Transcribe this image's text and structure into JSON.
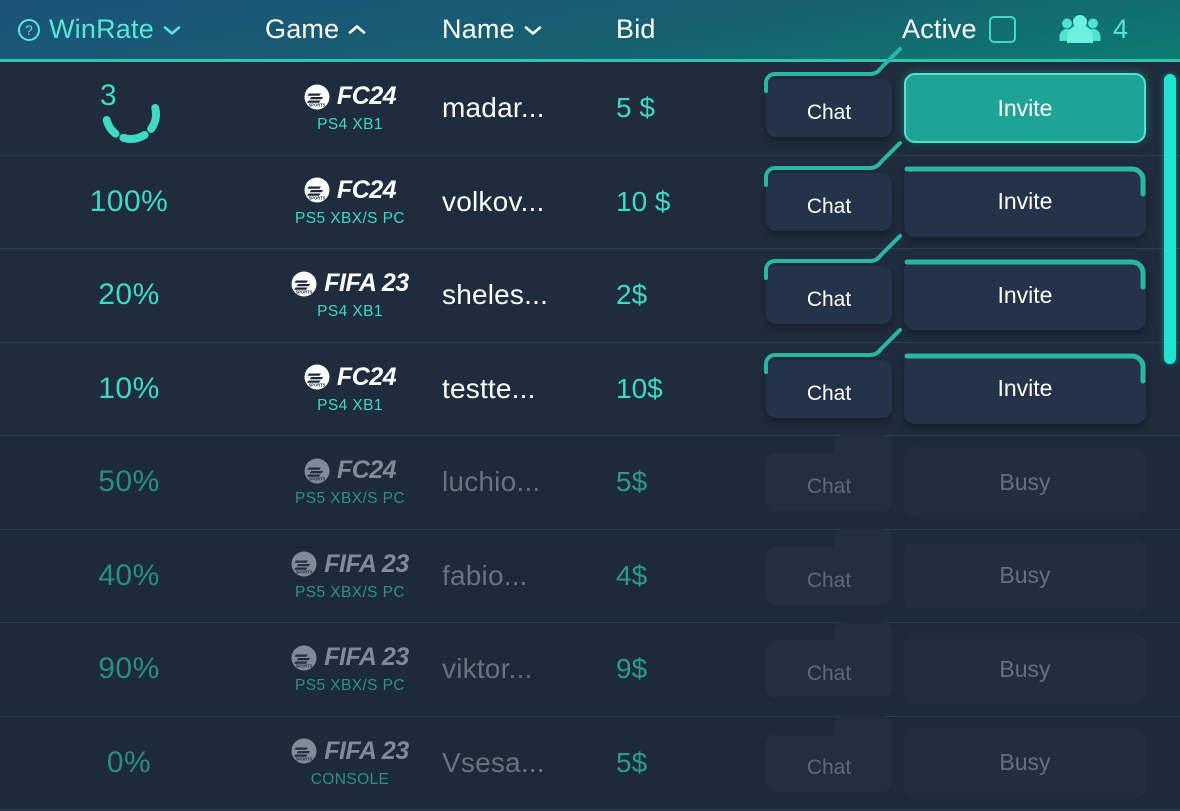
{
  "header": {
    "winrate": {
      "label": "WinRate",
      "help_icon": "question-circle-icon",
      "sort": "chevron-down-icon"
    },
    "game": {
      "label": "Game",
      "sort": "chevron-up-icon"
    },
    "name": {
      "label": "Name",
      "sort": "chevron-down-icon"
    },
    "bid": {
      "label": "Bid"
    },
    "active": {
      "label": "Active",
      "checked": false
    },
    "players": {
      "icon": "people-group-icon",
      "count": "4"
    },
    "accent_color": "#2ec4b0",
    "teal_text": "#56e8d7"
  },
  "rows": [
    {
      "winrate": "3",
      "winrate_loading": true,
      "game": "FC24",
      "platforms": "PS4 XB1",
      "name": "madar...",
      "bid": "5 $",
      "chat_label": "Chat",
      "action_label": "Invite",
      "action_state": "active",
      "disabled": false
    },
    {
      "winrate": "100%",
      "winrate_loading": false,
      "game": "FC24",
      "platforms": "PS5 XBX/S PC",
      "name": "volkov...",
      "bid": "10 $",
      "chat_label": "Chat",
      "action_label": "Invite",
      "action_state": "default",
      "disabled": false
    },
    {
      "winrate": "20%",
      "winrate_loading": false,
      "game": "FIFA 23",
      "platforms": "PS4 XB1",
      "name": "sheles...",
      "bid": "2$",
      "chat_label": "Chat",
      "action_label": "Invite",
      "action_state": "default",
      "disabled": false
    },
    {
      "winrate": "10%",
      "winrate_loading": false,
      "game": "FC24",
      "platforms": "PS4 XB1",
      "name": "testte...",
      "bid": "10$",
      "chat_label": "Chat",
      "action_label": "Invite",
      "action_state": "default",
      "disabled": false
    },
    {
      "winrate": "50%",
      "winrate_loading": false,
      "game": "FC24",
      "platforms": "PS5 XBX/S PC",
      "name": "luchio...",
      "bid": "5$",
      "chat_label": "Chat",
      "action_label": "Busy",
      "action_state": "busy",
      "disabled": true
    },
    {
      "winrate": "40%",
      "winrate_loading": false,
      "game": "FIFA 23",
      "platforms": "PS5 XBX/S PC",
      "name": "fabio...",
      "bid": "4$",
      "chat_label": "Chat",
      "action_label": "Busy",
      "action_state": "busy",
      "disabled": true
    },
    {
      "winrate": "90%",
      "winrate_loading": false,
      "game": "FIFA 23",
      "platforms": "PS5 XBX/S PC",
      "name": "viktor...",
      "bid": "9$",
      "chat_label": "Chat",
      "action_label": "Busy",
      "action_state": "busy",
      "disabled": true
    },
    {
      "winrate": "0%",
      "winrate_loading": false,
      "game": "FIFA 23",
      "platforms": "CONSOLE",
      "name": "Vsesa...",
      "bid": "5$",
      "chat_label": "Chat",
      "action_label": "Busy",
      "action_state": "busy",
      "disabled": true
    }
  ],
  "scrollbar": {
    "name": "vertical-scrollbar"
  }
}
